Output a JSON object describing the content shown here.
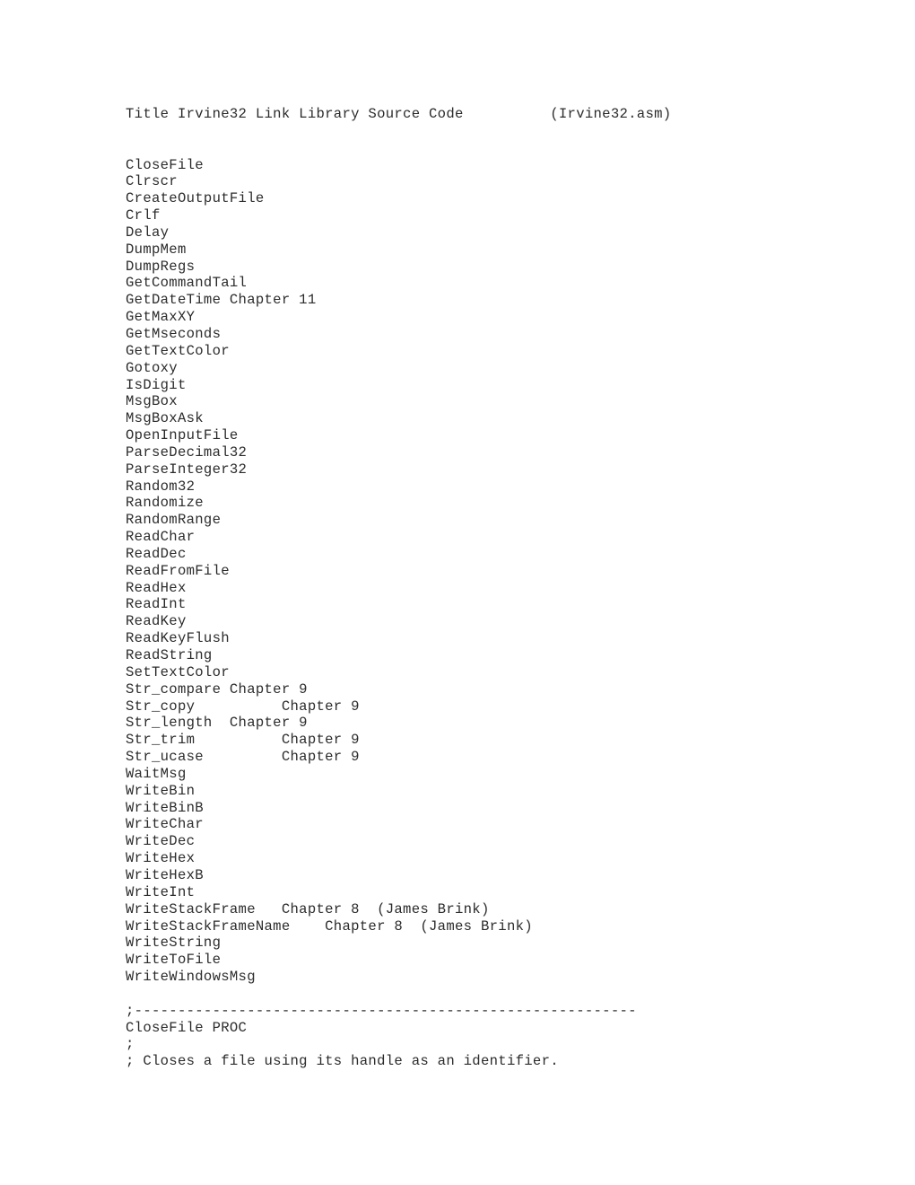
{
  "document": {
    "title_line": "Title Irvine32 Link Library Source Code          (Irvine32.asm)",
    "title_text": "Title Irvine32 Link Library Source Code",
    "filename_annotation": "(Irvine32.asm)",
    "separator_line": ";----------------------------------------------------------",
    "procedure_lines": [
      "CloseFile PROC",
      ";",
      "; Closes a file using its handle as an identifier."
    ],
    "procedure_list": [
      {
        "name": "CloseFile",
        "reference": ""
      },
      {
        "name": "Clrscr",
        "reference": ""
      },
      {
        "name": "CreateOutputFile",
        "reference": ""
      },
      {
        "name": "Crlf",
        "reference": ""
      },
      {
        "name": "Delay",
        "reference": ""
      },
      {
        "name": "DumpMem",
        "reference": ""
      },
      {
        "name": "DumpRegs",
        "reference": ""
      },
      {
        "name": "GetCommandTail",
        "reference": ""
      },
      {
        "name": "GetDateTime",
        "reference": "Chapter 11"
      },
      {
        "name": "GetMaxXY",
        "reference": ""
      },
      {
        "name": "GetMseconds",
        "reference": ""
      },
      {
        "name": "GetTextColor",
        "reference": ""
      },
      {
        "name": "Gotoxy",
        "reference": ""
      },
      {
        "name": "IsDigit",
        "reference": ""
      },
      {
        "name": "MsgBox",
        "reference": ""
      },
      {
        "name": "MsgBoxAsk",
        "reference": ""
      },
      {
        "name": "OpenInputFile",
        "reference": ""
      },
      {
        "name": "ParseDecimal32",
        "reference": ""
      },
      {
        "name": "ParseInteger32",
        "reference": ""
      },
      {
        "name": "Random32",
        "reference": ""
      },
      {
        "name": "Randomize",
        "reference": ""
      },
      {
        "name": "RandomRange",
        "reference": ""
      },
      {
        "name": "ReadChar",
        "reference": ""
      },
      {
        "name": "ReadDec",
        "reference": ""
      },
      {
        "name": "ReadFromFile",
        "reference": ""
      },
      {
        "name": "ReadHex",
        "reference": ""
      },
      {
        "name": "ReadInt",
        "reference": ""
      },
      {
        "name": "ReadKey",
        "reference": ""
      },
      {
        "name": "ReadKeyFlush",
        "reference": ""
      },
      {
        "name": "ReadString",
        "reference": ""
      },
      {
        "name": "SetTextColor",
        "reference": ""
      },
      {
        "name": "Str_compare",
        "reference": "Chapter 9"
      },
      {
        "name": "Str_copy",
        "reference": "Chapter 9"
      },
      {
        "name": "Str_length",
        "reference": "Chapter 9"
      },
      {
        "name": "Str_trim",
        "reference": "Chapter 9"
      },
      {
        "name": "Str_ucase",
        "reference": "Chapter 9"
      },
      {
        "name": "WaitMsg",
        "reference": ""
      },
      {
        "name": "WriteBin",
        "reference": ""
      },
      {
        "name": "WriteBinB",
        "reference": ""
      },
      {
        "name": "WriteChar",
        "reference": ""
      },
      {
        "name": "WriteDec",
        "reference": ""
      },
      {
        "name": "WriteHex",
        "reference": ""
      },
      {
        "name": "WriteHexB",
        "reference": ""
      },
      {
        "name": "WriteInt",
        "reference": ""
      },
      {
        "name": "WriteStackFrame",
        "reference": "Chapter 8",
        "credit": "(James Brink)"
      },
      {
        "name": "WriteStackFrameName",
        "reference": "Chapter 8",
        "credit": "(James Brink)"
      },
      {
        "name": "WriteString",
        "reference": ""
      },
      {
        "name": "WriteToFile",
        "reference": ""
      },
      {
        "name": "WriteWindowsMsg",
        "reference": ""
      }
    ],
    "full_text": "Title Irvine32 Link Library Source Code          (Irvine32.asm)\n\n\nCloseFile\nClrscr\nCreateOutputFile\nCrlf\nDelay\nDumpMem\nDumpRegs\nGetCommandTail\nGetDateTime Chapter 11\nGetMaxXY\nGetMseconds\nGetTextColor\nGotoxy\nIsDigit\nMsgBox\nMsgBoxAsk\nOpenInputFile\nParseDecimal32\nParseInteger32\nRandom32\nRandomize\nRandomRange\nReadChar\nReadDec\nReadFromFile\nReadHex\nReadInt\nReadKey\nReadKeyFlush\nReadString\nSetTextColor\nStr_compare Chapter 9\nStr_copy          Chapter 9\nStr_length  Chapter 9\nStr_trim          Chapter 9\nStr_ucase         Chapter 9\nWaitMsg\nWriteBin\nWriteBinB\nWriteChar\nWriteDec\nWriteHex\nWriteHexB\nWriteInt\nWriteStackFrame   Chapter 8  (James Brink)\nWriteStackFrameName    Chapter 8  (James Brink)\nWriteString\nWriteToFile\nWriteWindowsMsg\n\n;----------------------------------------------------------\nCloseFile PROC\n;\n; Closes a file using its handle as an identifier."
  }
}
